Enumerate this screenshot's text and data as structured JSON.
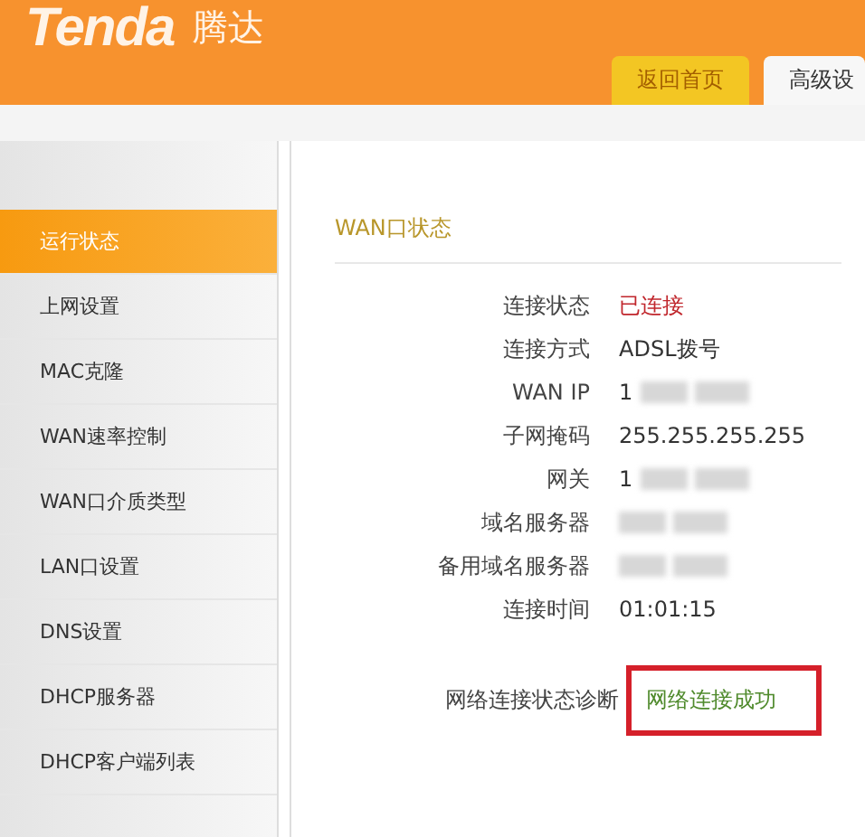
{
  "header": {
    "logo": "Tenda",
    "brand": "腾达"
  },
  "tabs": [
    {
      "label": "返回首页",
      "selected": false
    },
    {
      "label": "高级设",
      "selected": true
    }
  ],
  "sidebar": {
    "items": [
      {
        "label": "运行状态",
        "selected": true
      },
      {
        "label": "上网设置",
        "selected": false
      },
      {
        "label": "MAC克隆",
        "selected": false
      },
      {
        "label": "WAN速率控制",
        "selected": false
      },
      {
        "label": "WAN口介质类型",
        "selected": false
      },
      {
        "label": "LAN口设置",
        "selected": false
      },
      {
        "label": "DNS设置",
        "selected": false
      },
      {
        "label": "DHCP服务器",
        "selected": false
      },
      {
        "label": "DHCP客户端列表",
        "selected": false
      }
    ]
  },
  "section": {
    "title": "WAN口状态",
    "rows": [
      {
        "label": "连接状态",
        "value": "已连接",
        "kind": "alert"
      },
      {
        "label": "连接方式",
        "value": "ADSL拨号",
        "kind": "plain"
      },
      {
        "label": "WAN IP",
        "value": "1",
        "kind": "blurred"
      },
      {
        "label": "子网掩码",
        "value": "255.255.255.255",
        "kind": "plain"
      },
      {
        "label": "网关",
        "value": "1",
        "kind": "blurred"
      },
      {
        "label": "域名服务器",
        "kind": "blurred"
      },
      {
        "label": "备用域名服务器",
        "kind": "blurred"
      },
      {
        "label": "连接时间",
        "value": "01:01:15",
        "kind": "plain"
      }
    ],
    "diagnosis": {
      "label": "网络连接状态诊断",
      "value": "网络连接成功",
      "highlighted": true
    }
  }
}
